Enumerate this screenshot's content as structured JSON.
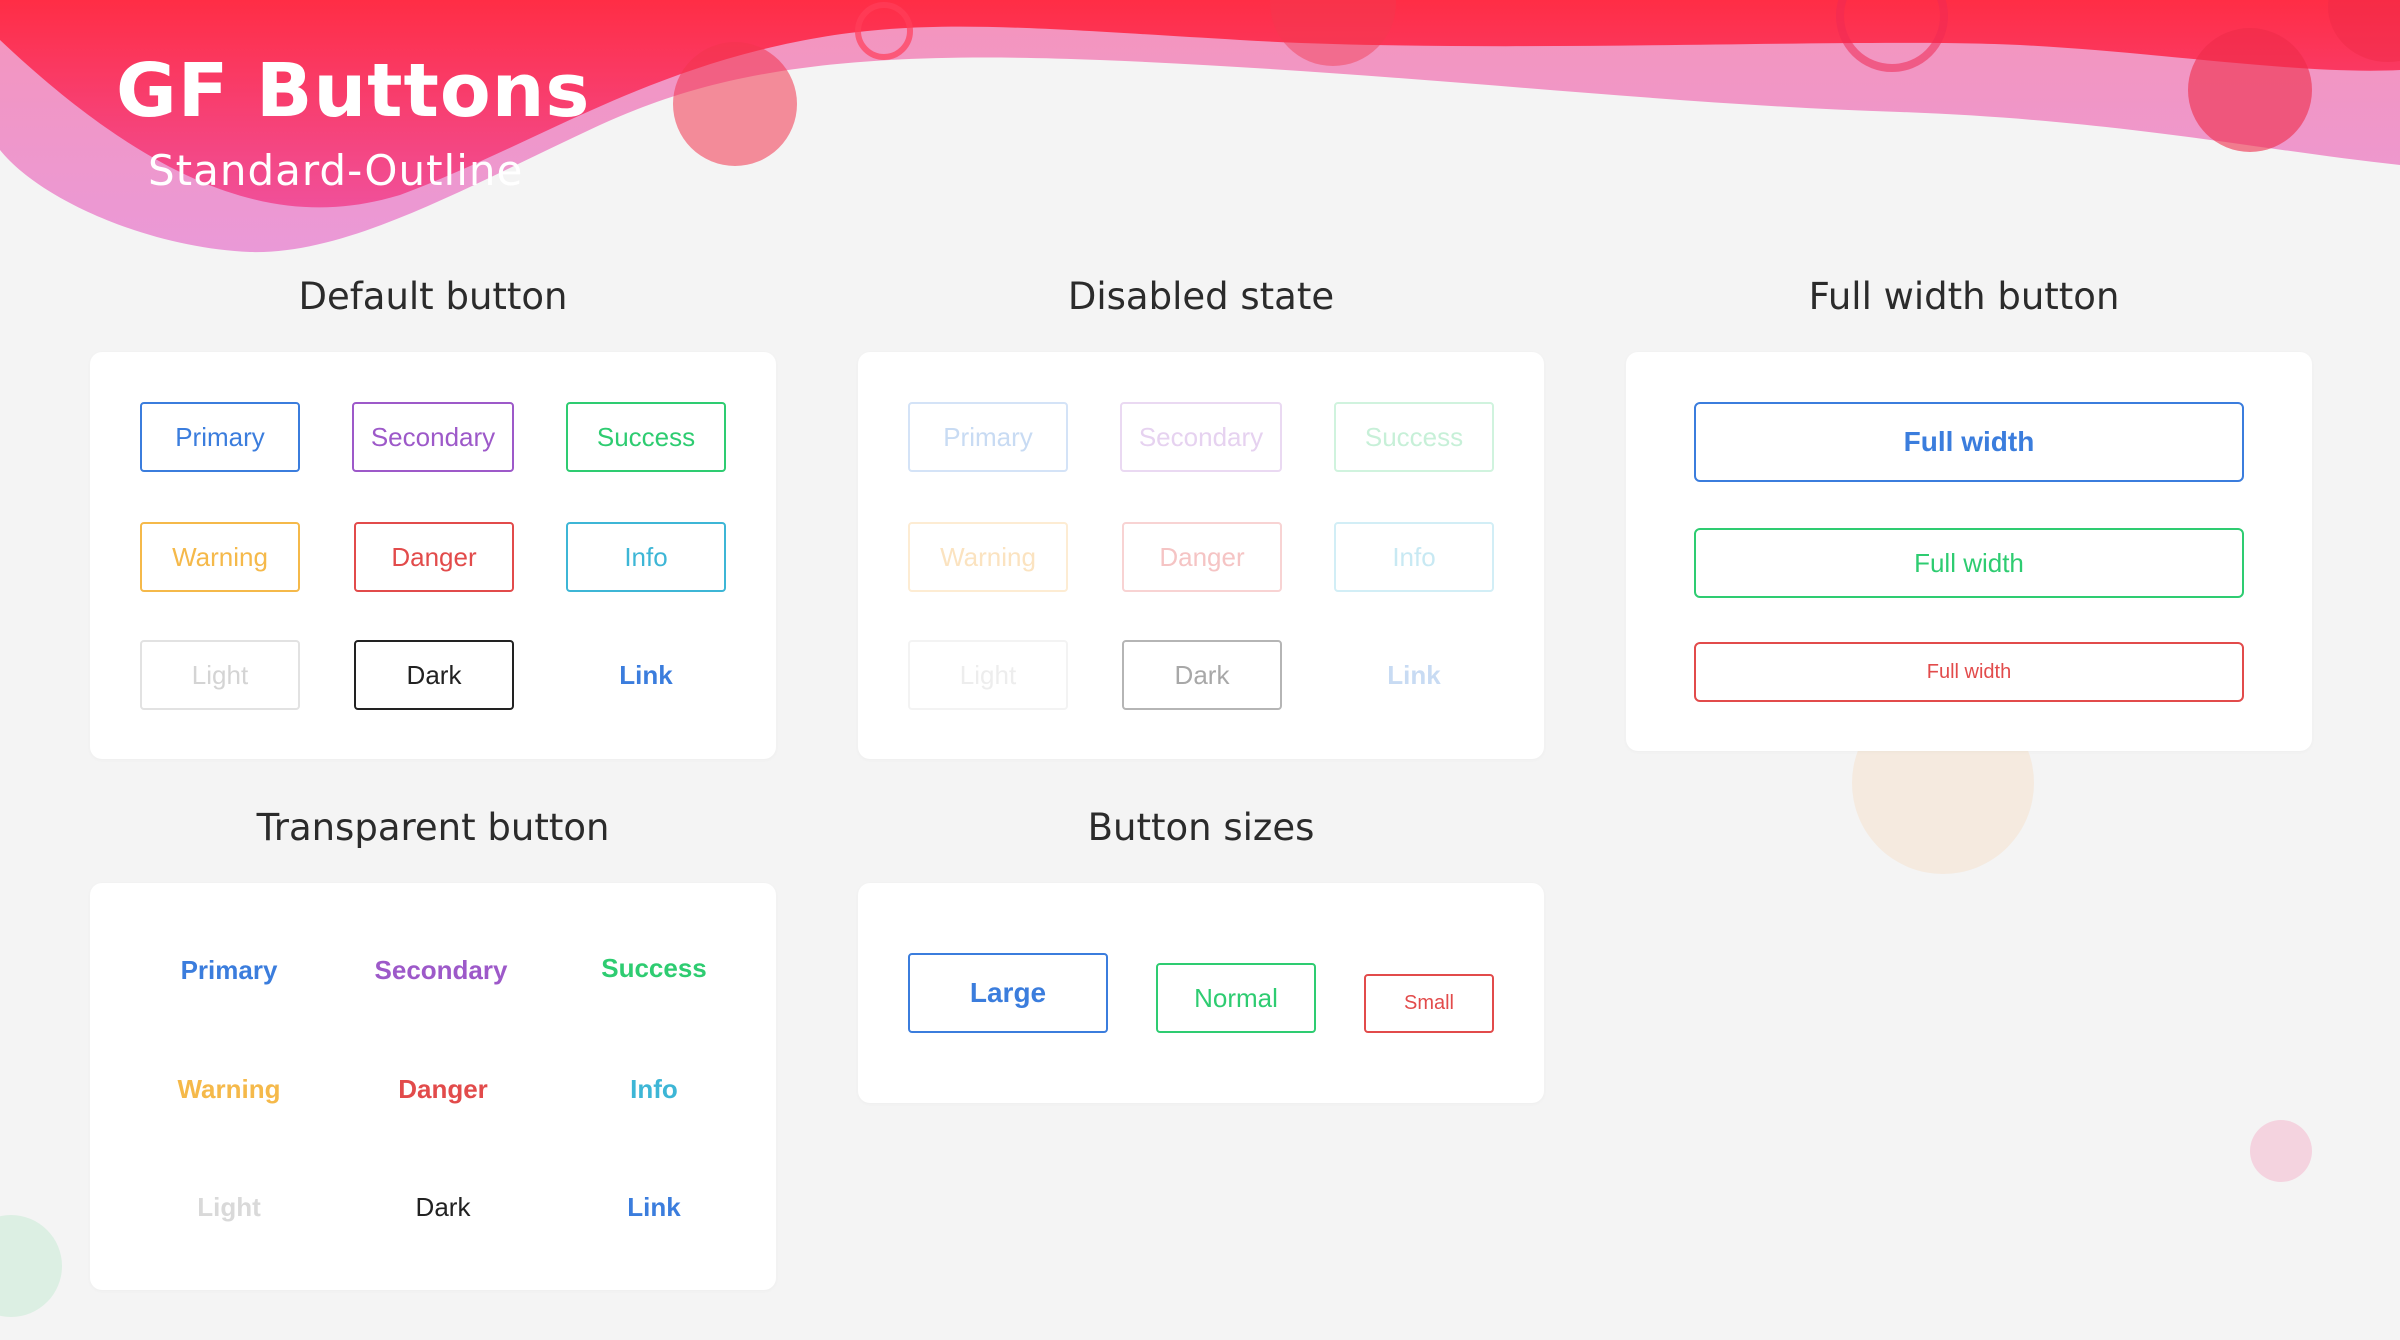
{
  "header": {
    "title": "GF Buttons",
    "subtitle": "Standard-Outline"
  },
  "colors": {
    "primary": "#3b7ddd",
    "secondary": "#9d59c9",
    "success": "#2ecc71",
    "warning": "#f5b94a",
    "danger": "#e24b4b",
    "info": "#3db6d6",
    "light": "#d9d9d9",
    "dark": "#222222",
    "link": "#3b7ddd",
    "hero_top": "#ff2d4a",
    "hero_bottom": "#e85ac8"
  },
  "sections": {
    "default": {
      "title": "Default button",
      "buttons": [
        "Primary",
        "Secondary",
        "Success",
        "Warning",
        "Danger",
        "Info",
        "Light",
        "Dark",
        "Link"
      ]
    },
    "disabled": {
      "title": "Disabled  state",
      "buttons": [
        "Primary",
        "Secondary",
        "Success",
        "Warning",
        "Danger",
        "Info",
        "Light",
        "Dark",
        "Link"
      ]
    },
    "full_width": {
      "title": "Full width button",
      "buttons": [
        "Full width",
        "Full width",
        "Full width"
      ]
    },
    "transparent": {
      "title": "Transparent button",
      "buttons": [
        "Primary",
        "Secondary",
        "Success",
        "Warning",
        "Danger",
        "Info",
        "Light",
        "Dark",
        "Link"
      ]
    },
    "sizes": {
      "title": "Button sizes",
      "buttons": [
        "Large",
        "Normal",
        "Small"
      ]
    }
  }
}
